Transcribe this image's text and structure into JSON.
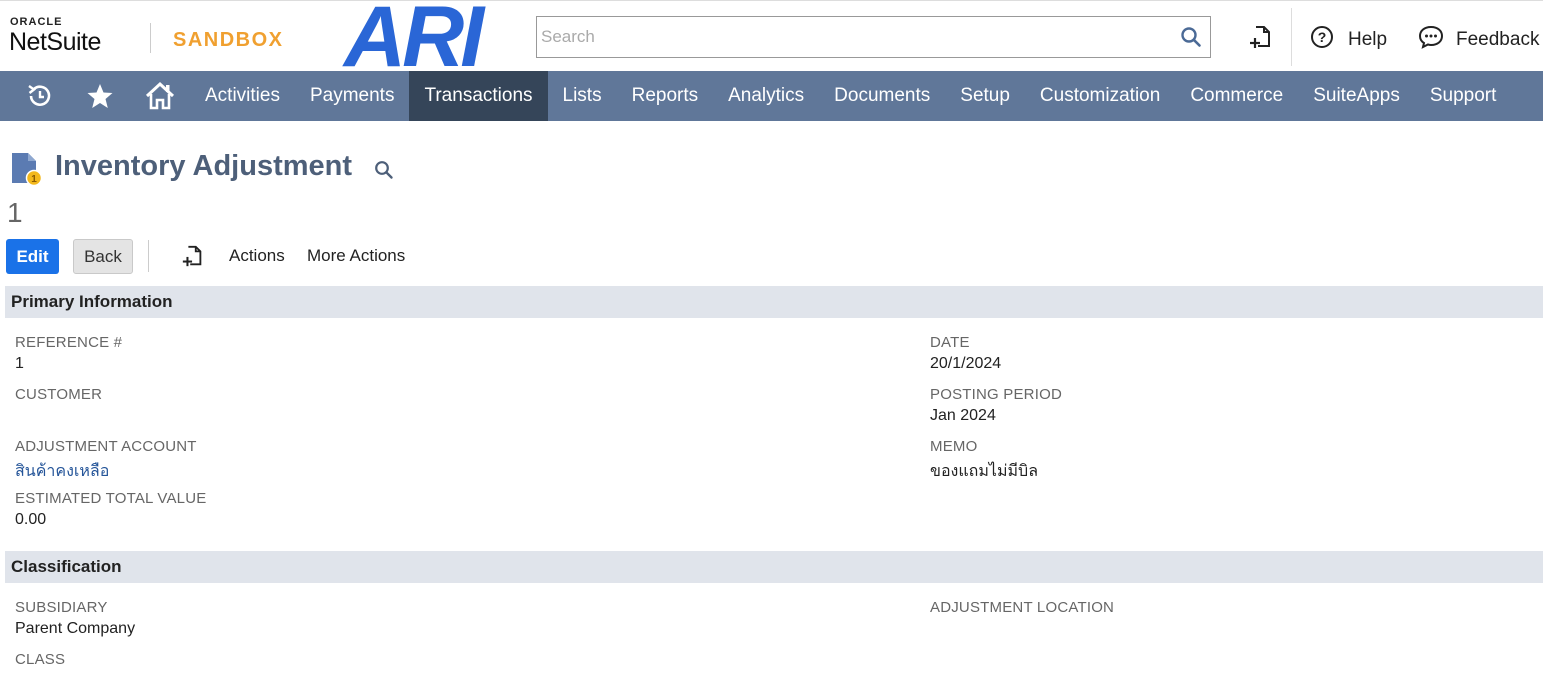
{
  "header": {
    "oracle_label": "ORACLE",
    "netsuite_label": "NetSuite",
    "sandbox_label": "SANDBOX",
    "brand_logo_text": "ARI",
    "search_placeholder": "Search",
    "help_label": "Help",
    "feedback_label": "Feedback"
  },
  "nav": {
    "icons": [
      "recent-records-icon",
      "star-icon",
      "home-icon"
    ],
    "items": [
      {
        "label": "Activities",
        "active": false
      },
      {
        "label": "Payments",
        "active": false
      },
      {
        "label": "Transactions",
        "active": true
      },
      {
        "label": "Lists",
        "active": false
      },
      {
        "label": "Reports",
        "active": false
      },
      {
        "label": "Analytics",
        "active": false
      },
      {
        "label": "Documents",
        "active": false
      },
      {
        "label": "Setup",
        "active": false
      },
      {
        "label": "Customization",
        "active": false
      },
      {
        "label": "Commerce",
        "active": false
      },
      {
        "label": "SuiteApps",
        "active": false
      },
      {
        "label": "Support",
        "active": false
      }
    ]
  },
  "page": {
    "title": "Inventory Adjustment",
    "record_number": "1"
  },
  "toolbar": {
    "edit_label": "Edit",
    "back_label": "Back",
    "actions_label": "Actions",
    "more_actions_label": "More Actions"
  },
  "primary": {
    "header": "Primary Information",
    "reference_label": "REFERENCE #",
    "reference_value": "1",
    "customer_label": "CUSTOMER",
    "adjustment_account_label": "ADJUSTMENT ACCOUNT",
    "adjustment_account_value": "สินค้าคงเหลือ",
    "estimated_total_label": "ESTIMATED TOTAL VALUE",
    "estimated_total_value": "0.00",
    "date_label": "DATE",
    "date_value": "20/1/2024",
    "posting_period_label": "POSTING PERIOD",
    "posting_period_value": "Jan 2024",
    "memo_label": "MEMO",
    "memo_value": "ของแถมไม่มีบิล"
  },
  "classification": {
    "header": "Classification",
    "subsidiary_label": "SUBSIDIARY",
    "subsidiary_value": "Parent Company",
    "class_label": "CLASS",
    "adjustment_location_label": "ADJUSTMENT LOCATION"
  },
  "colors": {
    "nav_bg": "#607799",
    "nav_active": "#354559",
    "primary_button": "#1a72e8",
    "sandbox": "#f0a030",
    "brand_blue": "#2a66d6",
    "link": "#255599",
    "section_bg": "#e0e4eb"
  }
}
